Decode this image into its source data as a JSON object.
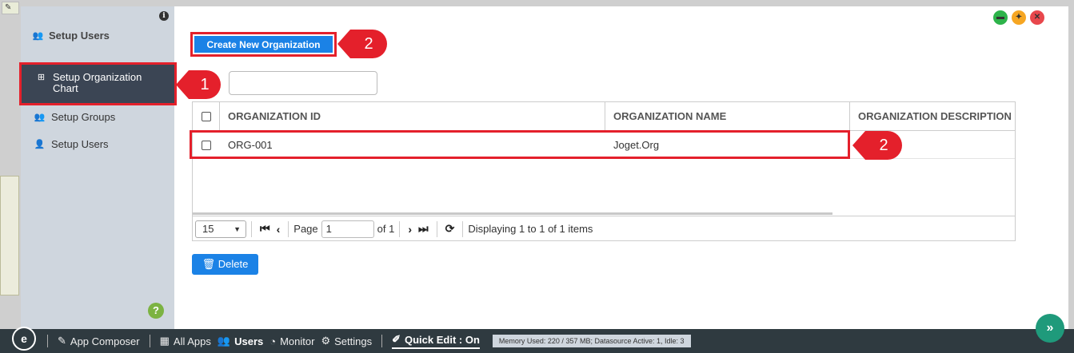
{
  "sidebar": {
    "header": "Setup Users",
    "items": [
      {
        "label": "Setup Organization Chart",
        "icon": "org-chart-icon",
        "active": true
      },
      {
        "label": "Setup Groups",
        "icon": "users-icon"
      },
      {
        "label": "Setup Users",
        "icon": "user-icon"
      }
    ]
  },
  "toolbar": {
    "create_label": "Create New Organization"
  },
  "callouts": {
    "one": "1",
    "two_a": "2",
    "two_b": "2"
  },
  "grid": {
    "columns": [
      "ORGANIZATION ID",
      "ORGANIZATION NAME",
      "ORGANIZATION DESCRIPTION"
    ],
    "rows": [
      {
        "id": "ORG-001",
        "name": "Joget.Org",
        "description": ""
      }
    ]
  },
  "pager": {
    "page_size": "15",
    "page_label": "Page",
    "page_value": "1",
    "of_label": "of 1",
    "display_text": "Displaying 1 to 1 of 1 items"
  },
  "actions": {
    "delete_label": "Delete"
  },
  "taskbar": {
    "app_composer": "App Composer",
    "all_apps": "All Apps",
    "users": "Users",
    "monitor": "Monitor",
    "settings": "Settings",
    "quick_edit": "Quick Edit : On",
    "memory": "Memory Used: 220 / 357 MB; Datasource Active: 1, Idle: 3"
  },
  "colors": {
    "accent": "#1b82e6",
    "callout": "#e4202b",
    "sidebar_active": "#3b4554",
    "taskbar": "#2f3a40"
  }
}
